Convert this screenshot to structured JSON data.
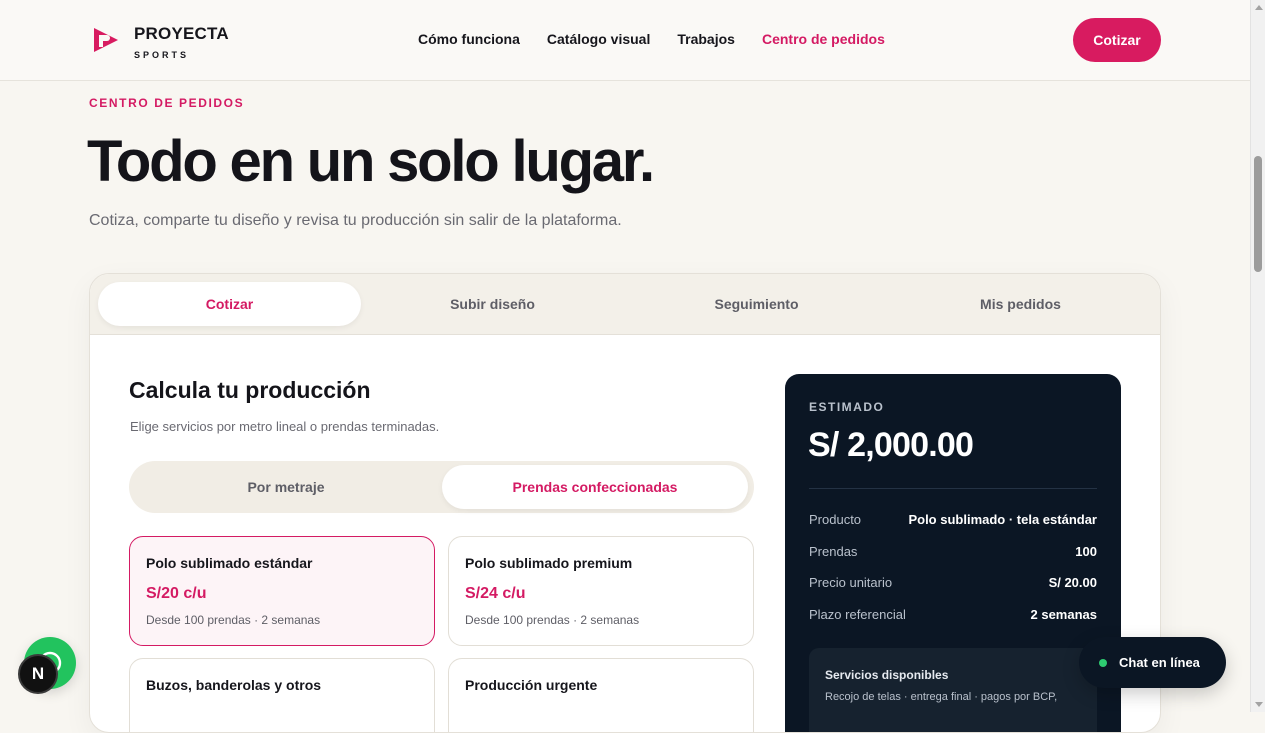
{
  "brand": {
    "name": "PROYECTA",
    "tagline": "SPORTS",
    "accent": "#d81b60"
  },
  "nav": {
    "items": [
      {
        "label": "Cómo funciona",
        "active": false
      },
      {
        "label": "Catálogo visual",
        "active": false
      },
      {
        "label": "Trabajos",
        "active": false
      },
      {
        "label": "Centro de pedidos",
        "active": true
      }
    ],
    "cta_label": "Cotizar"
  },
  "hero": {
    "eyebrow": "CENTRO DE PEDIDOS",
    "title": "Todo en un solo lugar.",
    "subtitle": "Cotiza, comparte tu diseño y revisa tu producción sin salir de la plataforma."
  },
  "tabs": [
    {
      "label": "Cotizar",
      "active": true
    },
    {
      "label": "Subir diseño",
      "active": false
    },
    {
      "label": "Seguimiento",
      "active": false
    },
    {
      "label": "Mis pedidos",
      "active": false
    }
  ],
  "calculator": {
    "title": "Calcula tu producción",
    "subtitle": "Elige servicios por metro lineal o prendas terminadas.",
    "modes": [
      {
        "label": "Por metraje",
        "active": false
      },
      {
        "label": "Prendas confeccionadas",
        "active": true
      }
    ],
    "products": [
      {
        "name": "Polo sublimado estándar",
        "price": "S/20 c/u",
        "meta": "Desde 100 prendas · 2 semanas",
        "selected": true
      },
      {
        "name": "Polo sublimado premium",
        "price": "S/24 c/u",
        "meta": "Desde 100 prendas · 2 semanas",
        "selected": false
      },
      {
        "name": "Buzos, banderolas y otros",
        "price": "",
        "meta": "",
        "selected": false
      },
      {
        "name": "Producción urgente",
        "price": "",
        "meta": "",
        "selected": false
      }
    ]
  },
  "estimate": {
    "label": "ESTIMADO",
    "total": "S/ 2,000.00",
    "rows": [
      {
        "key": "Producto",
        "value": "Polo sublimado · tela estándar"
      },
      {
        "key": "Prendas",
        "value": "100"
      },
      {
        "key": "Precio unitario",
        "value": "S/ 20.00"
      },
      {
        "key": "Plazo referencial",
        "value": "2 semanas"
      }
    ],
    "services_title": "Servicios disponibles",
    "services_text": "Recojo de telas · entrega final · pagos por BCP,"
  },
  "chat": {
    "label": "Chat en línea",
    "status_color": "#2ecc71"
  },
  "widgets": {
    "whatsapp_icon": "whatsapp-icon",
    "dev_badge": "N"
  }
}
